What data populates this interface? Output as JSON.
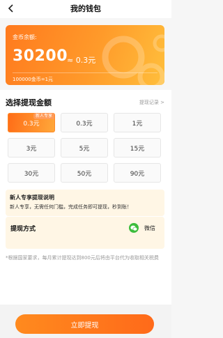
{
  "header": {
    "title": "我的钱包",
    "back_icon": "back-arrow-icon"
  },
  "balance": {
    "label": "金币余额:",
    "coins": "30200",
    "money": "≈ 0.3元",
    "rate_note": "100000金币=1元"
  },
  "withdraw": {
    "section_title": "选择提现金额",
    "record_link": "提现记录 >",
    "options": [
      {
        "label": "0.3元",
        "selected": true,
        "badge": "新人专享"
      },
      {
        "label": "0.3元"
      },
      {
        "label": "1元"
      },
      {
        "label": "3元"
      },
      {
        "label": "5元"
      },
      {
        "label": "15元"
      },
      {
        "label": "30元"
      },
      {
        "label": "50元"
      },
      {
        "label": "90元"
      }
    ]
  },
  "notice": {
    "title": "新人专享提现说明",
    "text": "新人专享，无需任何门槛，完成任务即可提现，秒到账！"
  },
  "method": {
    "label": "提现方式",
    "option": "微信",
    "icon": "wechat-icon"
  },
  "tax_note": "*根据国家要求，每月累计提现达到800元后将由平台代为收取相关税费",
  "action": {
    "button_label": "立即提现"
  },
  "colors": {
    "accent": "#ff7a1e",
    "wechat": "#3dbd3d",
    "notice_bg": "#fff6e5"
  }
}
